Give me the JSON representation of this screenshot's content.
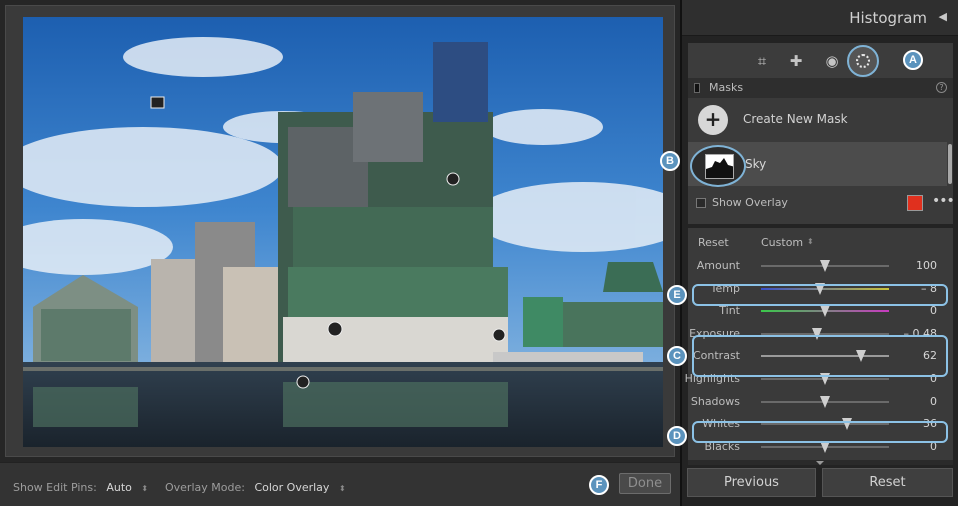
{
  "panel": {
    "title": "Histogram",
    "collapse_icon": "triangle-left-icon"
  },
  "tools": [
    {
      "name": "crop-icon"
    },
    {
      "name": "healing-icon"
    },
    {
      "name": "red-eye-icon"
    },
    {
      "name": "masking-icon",
      "active": true
    }
  ],
  "masks": {
    "header": "Masks",
    "create_label": "Create New Mask",
    "mask_name": "Sky",
    "show_overlay_label": "Show Overlay",
    "overlay_color": "#e0301e"
  },
  "adjust": {
    "reset_label": "Reset",
    "preset_label": "Custom",
    "sliders": [
      {
        "label": "Amount",
        "value": "100",
        "fraction": 0.5
      },
      {
        "label": "Temp",
        "value": "– 8",
        "fraction": 0.46
      },
      {
        "label": "Tint",
        "value": "0",
        "fraction": 0.5
      },
      {
        "label": "Exposure",
        "value": "– 0.48",
        "fraction": 0.44
      },
      {
        "label": "Contrast",
        "value": "62",
        "fraction": 0.78
      },
      {
        "label": "Highlights",
        "value": "0",
        "fraction": 0.5
      },
      {
        "label": "Shadows",
        "value": "0",
        "fraction": 0.5
      },
      {
        "label": "Whites",
        "value": "36",
        "fraction": 0.67
      },
      {
        "label": "Blacks",
        "value": "0",
        "fraction": 0.5
      }
    ]
  },
  "buttons": {
    "previous": "Previous",
    "reset": "Reset",
    "done": "Done"
  },
  "toolbar": {
    "edit_pins_label": "Show Edit Pins:",
    "edit_pins_value": "Auto",
    "overlay_mode_label": "Overlay Mode:",
    "overlay_mode_value": "Color Overlay"
  },
  "callouts": [
    "A",
    "B",
    "C",
    "D",
    "E",
    "F"
  ]
}
